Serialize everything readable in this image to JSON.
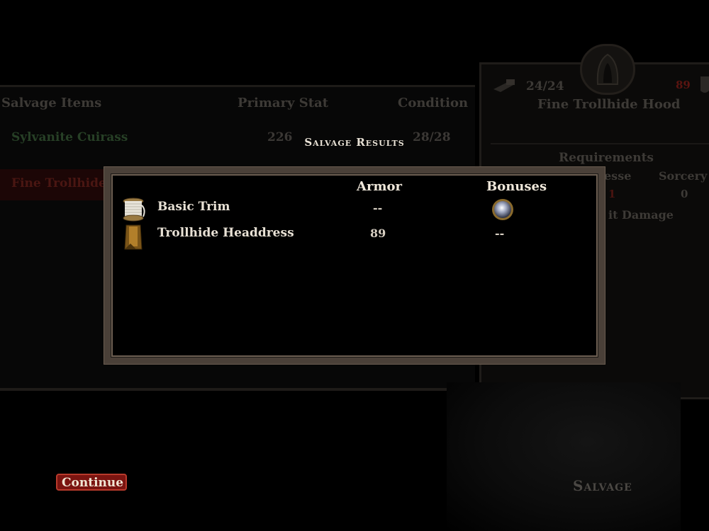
{
  "background_list": {
    "headers": {
      "items": "Salvage Items",
      "primary": "Primary Stat",
      "condition": "Condition"
    },
    "rows": [
      {
        "name": "Sylvanite Cuirass",
        "primary": "226",
        "condition": "28/28",
        "color": "#274026"
      },
      {
        "name": "Fine Trollhide",
        "primary": "",
        "condition": "",
        "color": "#4a1612"
      }
    ]
  },
  "item_card": {
    "durability": "24/24",
    "armor_value": "89",
    "name": "Fine Trollhide Hood",
    "requirements_label": "Requirements",
    "req_left_partial": "esse",
    "req_right": "Sorcery",
    "req_left_value": "1",
    "req_right_value": "0",
    "partial_stat": "it Damage"
  },
  "modal": {
    "title": "Salvage Results",
    "columns": {
      "armor": "Armor",
      "bonuses": "Bonuses"
    },
    "rows": [
      {
        "name": "Basic Trim",
        "armor": "--",
        "bonus_icon": "orb-icon",
        "bonus": ""
      },
      {
        "name": "Trollhide Headdress",
        "armor": "89",
        "bonus_icon": "",
        "bonus": "--"
      }
    ]
  },
  "buttons": {
    "continue": "Continue"
  },
  "screen_label": "Salvage",
  "colors": {
    "accent_red": "#7b1410",
    "frame": "#4a4038"
  }
}
